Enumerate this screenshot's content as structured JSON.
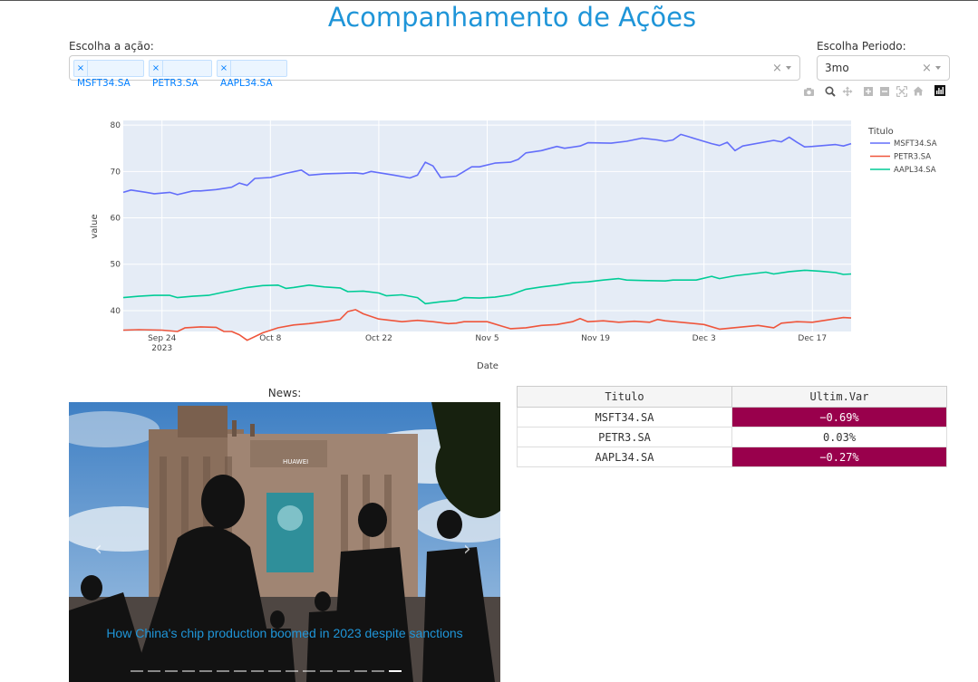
{
  "page": {
    "title": "Acompanhamento de Ações"
  },
  "stock_selector": {
    "label": "Escolha a ação:",
    "selected": [
      "MSFT34.SA",
      "PETR3.SA",
      "AAPL34.SA"
    ]
  },
  "period_selector": {
    "label": "Escolha Periodo:",
    "value": "3mo"
  },
  "modebar": {
    "icons": [
      "camera-icon",
      "zoom-icon",
      "pan-icon",
      "zoom-in-icon",
      "zoom-out-icon",
      "autoscale-icon",
      "reset-axes-icon",
      "plotly-logo-icon"
    ]
  },
  "chart_data": {
    "type": "line",
    "xlabel": "Date",
    "ylabel": "value",
    "legend_title": "Titulo",
    "legend_position": "right",
    "x_range": [
      "2023-09-19",
      "2023-12-22"
    ],
    "ylim": [
      35.5,
      81
    ],
    "yticks": [
      40,
      50,
      60,
      70,
      80
    ],
    "xticks": [
      {
        "date": "2023-09-24",
        "label": "Sep 24",
        "sublabel": "2023"
      },
      {
        "date": "2023-10-08",
        "label": "Oct 8"
      },
      {
        "date": "2023-10-22",
        "label": "Oct 22"
      },
      {
        "date": "2023-11-05",
        "label": "Nov 5"
      },
      {
        "date": "2023-11-19",
        "label": "Nov 19"
      },
      {
        "date": "2023-12-03",
        "label": "Dec 3"
      },
      {
        "date": "2023-12-17",
        "label": "Dec 17"
      }
    ],
    "series": [
      {
        "name": "MSFT34.SA",
        "color": "#636efa",
        "points": [
          [
            "2023-09-19",
            65.5
          ],
          [
            "2023-09-20",
            66
          ],
          [
            "2023-09-22",
            65.5
          ],
          [
            "2023-09-23",
            65.2
          ],
          [
            "2023-09-25",
            65.5
          ],
          [
            "2023-09-26",
            65
          ],
          [
            "2023-09-28",
            65.8
          ],
          [
            "2023-09-29",
            65.8
          ],
          [
            "2023-10-01",
            66.1
          ],
          [
            "2023-10-03",
            66.6
          ],
          [
            "2023-10-04",
            67.5
          ],
          [
            "2023-10-05",
            67
          ],
          [
            "2023-10-06",
            68.5
          ],
          [
            "2023-10-08",
            68.7
          ],
          [
            "2023-10-10",
            69.6
          ],
          [
            "2023-10-12",
            70.3
          ],
          [
            "2023-10-13",
            69.2
          ],
          [
            "2023-10-15",
            69.5
          ],
          [
            "2023-10-17",
            69.6
          ],
          [
            "2023-10-19",
            69.7
          ],
          [
            "2023-10-20",
            69.5
          ],
          [
            "2023-10-21",
            70
          ],
          [
            "2023-10-24",
            69.2
          ],
          [
            "2023-10-26",
            68.6
          ],
          [
            "2023-10-27",
            69.2
          ],
          [
            "2023-10-28",
            72
          ],
          [
            "2023-10-29",
            71.2
          ],
          [
            "2023-10-30",
            68.7
          ],
          [
            "2023-11-01",
            69
          ],
          [
            "2023-11-03",
            71
          ],
          [
            "2023-11-04",
            71
          ],
          [
            "2023-11-06",
            71.8
          ],
          [
            "2023-11-08",
            72
          ],
          [
            "2023-11-09",
            72.6
          ],
          [
            "2023-11-10",
            74
          ],
          [
            "2023-11-12",
            74.5
          ],
          [
            "2023-11-14",
            75.4
          ],
          [
            "2023-11-15",
            75
          ],
          [
            "2023-11-17",
            75.5
          ],
          [
            "2023-11-18",
            76.2
          ],
          [
            "2023-11-21",
            76.1
          ],
          [
            "2023-11-23",
            76.5
          ],
          [
            "2023-11-25",
            77.2
          ],
          [
            "2023-11-27",
            76.8
          ],
          [
            "2023-11-28",
            76.5
          ],
          [
            "2023-11-29",
            76.8
          ],
          [
            "2023-11-30",
            78
          ],
          [
            "2023-12-01",
            77.5
          ],
          [
            "2023-12-02",
            77
          ],
          [
            "2023-12-04",
            76
          ],
          [
            "2023-12-05",
            75.6
          ],
          [
            "2023-12-06",
            76.3
          ],
          [
            "2023-12-07",
            74.5
          ],
          [
            "2023-12-08",
            75.5
          ],
          [
            "2023-12-12",
            76.7
          ],
          [
            "2023-12-13",
            76.4
          ],
          [
            "2023-12-14",
            77.4
          ],
          [
            "2023-12-15",
            76.3
          ],
          [
            "2023-12-16",
            75.3
          ],
          [
            "2023-12-17",
            75.4
          ],
          [
            "2023-12-20",
            75.8
          ],
          [
            "2023-12-21",
            75.5
          ],
          [
            "2023-12-22",
            76
          ]
        ]
      },
      {
        "name": "PETR3.SA",
        "color": "#ef553b",
        "points": [
          [
            "2023-09-19",
            35.8
          ],
          [
            "2023-09-21",
            35.9
          ],
          [
            "2023-09-24",
            35.8
          ],
          [
            "2023-09-26",
            35.5
          ],
          [
            "2023-09-27",
            36.3
          ],
          [
            "2023-09-29",
            36.5
          ],
          [
            "2023-10-01",
            36.4
          ],
          [
            "2023-10-02",
            35.5
          ],
          [
            "2023-10-03",
            35.5
          ],
          [
            "2023-10-04",
            34.8
          ],
          [
            "2023-10-05",
            33.6
          ],
          [
            "2023-10-07",
            35.2
          ],
          [
            "2023-10-09",
            36.3
          ],
          [
            "2023-10-11",
            36.9
          ],
          [
            "2023-10-13",
            37.2
          ],
          [
            "2023-10-15",
            37.6
          ],
          [
            "2023-10-17",
            38.1
          ],
          [
            "2023-10-18",
            39.8
          ],
          [
            "2023-10-19",
            40.2
          ],
          [
            "2023-10-20",
            39.3
          ],
          [
            "2023-10-22",
            38.2
          ],
          [
            "2023-10-24",
            37.8
          ],
          [
            "2023-10-25",
            37.6
          ],
          [
            "2023-10-27",
            37.9
          ],
          [
            "2023-10-29",
            37.6
          ],
          [
            "2023-10-31",
            37.2
          ],
          [
            "2023-11-01",
            37.3
          ],
          [
            "2023-11-02",
            37.6
          ],
          [
            "2023-11-03",
            37.6
          ],
          [
            "2023-11-05",
            37.6
          ],
          [
            "2023-11-07",
            36.6
          ],
          [
            "2023-11-08",
            36.1
          ],
          [
            "2023-11-10",
            36.3
          ],
          [
            "2023-11-12",
            36.8
          ],
          [
            "2023-11-14",
            37
          ],
          [
            "2023-11-16",
            37.6
          ],
          [
            "2023-11-17",
            38.3
          ],
          [
            "2023-11-18",
            37.6
          ],
          [
            "2023-11-20",
            37.8
          ],
          [
            "2023-11-22",
            37.5
          ],
          [
            "2023-11-24",
            37.7
          ],
          [
            "2023-11-26",
            37.5
          ],
          [
            "2023-11-27",
            38.1
          ],
          [
            "2023-11-28",
            37.8
          ],
          [
            "2023-11-30",
            37.5
          ],
          [
            "2023-12-03",
            37
          ],
          [
            "2023-12-05",
            36
          ],
          [
            "2023-12-08",
            36.5
          ],
          [
            "2023-12-10",
            36.8
          ],
          [
            "2023-12-12",
            36.3
          ],
          [
            "2023-12-13",
            37.3
          ],
          [
            "2023-12-15",
            37.6
          ],
          [
            "2023-12-17",
            37.5
          ],
          [
            "2023-12-19",
            38
          ],
          [
            "2023-12-21",
            38.5
          ],
          [
            "2023-12-22",
            38.4
          ]
        ]
      },
      {
        "name": "AAPL34.SA",
        "color": "#00cc96",
        "points": [
          [
            "2023-09-19",
            42.8
          ],
          [
            "2023-09-21",
            43.1
          ],
          [
            "2023-09-23",
            43.3
          ],
          [
            "2023-09-25",
            43.3
          ],
          [
            "2023-09-26",
            42.8
          ],
          [
            "2023-09-28",
            43.1
          ],
          [
            "2023-09-30",
            43.3
          ],
          [
            "2023-10-02",
            44
          ],
          [
            "2023-10-03",
            44.3
          ],
          [
            "2023-10-05",
            45
          ],
          [
            "2023-10-07",
            45.4
          ],
          [
            "2023-10-09",
            45.5
          ],
          [
            "2023-10-10",
            44.8
          ],
          [
            "2023-10-11",
            45
          ],
          [
            "2023-10-13",
            45.5
          ],
          [
            "2023-10-15",
            45.1
          ],
          [
            "2023-10-17",
            44.9
          ],
          [
            "2023-10-18",
            44.1
          ],
          [
            "2023-10-20",
            44.2
          ],
          [
            "2023-10-22",
            43.8
          ],
          [
            "2023-10-23",
            43.2
          ],
          [
            "2023-10-25",
            43.4
          ],
          [
            "2023-10-27",
            42.8
          ],
          [
            "2023-10-28",
            41.5
          ],
          [
            "2023-10-30",
            41.9
          ],
          [
            "2023-11-01",
            42.2
          ],
          [
            "2023-11-02",
            42.8
          ],
          [
            "2023-11-04",
            42.7
          ],
          [
            "2023-11-06",
            42.9
          ],
          [
            "2023-11-08",
            43.4
          ],
          [
            "2023-11-10",
            44.6
          ],
          [
            "2023-11-12",
            45.1
          ],
          [
            "2023-11-14",
            45.5
          ],
          [
            "2023-11-16",
            46
          ],
          [
            "2023-11-18",
            46.2
          ],
          [
            "2023-11-20",
            46.6
          ],
          [
            "2023-11-22",
            46.9
          ],
          [
            "2023-11-23",
            46.6
          ],
          [
            "2023-11-25",
            46.5
          ],
          [
            "2023-11-28",
            46.4
          ],
          [
            "2023-11-29",
            46.6
          ],
          [
            "2023-12-02",
            46.6
          ],
          [
            "2023-12-04",
            47.4
          ],
          [
            "2023-12-05",
            46.9
          ],
          [
            "2023-12-07",
            47.5
          ],
          [
            "2023-12-09",
            47.9
          ],
          [
            "2023-12-11",
            48.3
          ],
          [
            "2023-12-12",
            47.9
          ],
          [
            "2023-12-14",
            48.4
          ],
          [
            "2023-12-16",
            48.7
          ],
          [
            "2023-12-18",
            48.5
          ],
          [
            "2023-12-20",
            48.2
          ],
          [
            "2023-12-21",
            47.8
          ],
          [
            "2023-12-22",
            47.9
          ]
        ]
      }
    ]
  },
  "news": {
    "label": "News:",
    "headline": "How China's chip production boomed in 2023 despite sanctions",
    "image_alt": "People walking past the Huawei flagship store",
    "storefront_text": "HUAWEI",
    "slide_count": 16,
    "active_slide": 15,
    "prev_icon": "chevron-left-icon",
    "next_icon": "chevron-right-icon"
  },
  "variation_table": {
    "headers": [
      "Titulo",
      "Ultim.Var"
    ],
    "rows": [
      {
        "ticker": "MSFT34.SA",
        "value": "−0.69%",
        "negative": true
      },
      {
        "ticker": "PETR3.SA",
        "value": "0.03%",
        "negative": false
      },
      {
        "ticker": "AAPL34.SA",
        "value": "−0.27%",
        "negative": true
      }
    ],
    "negative_color": "#99004c"
  }
}
